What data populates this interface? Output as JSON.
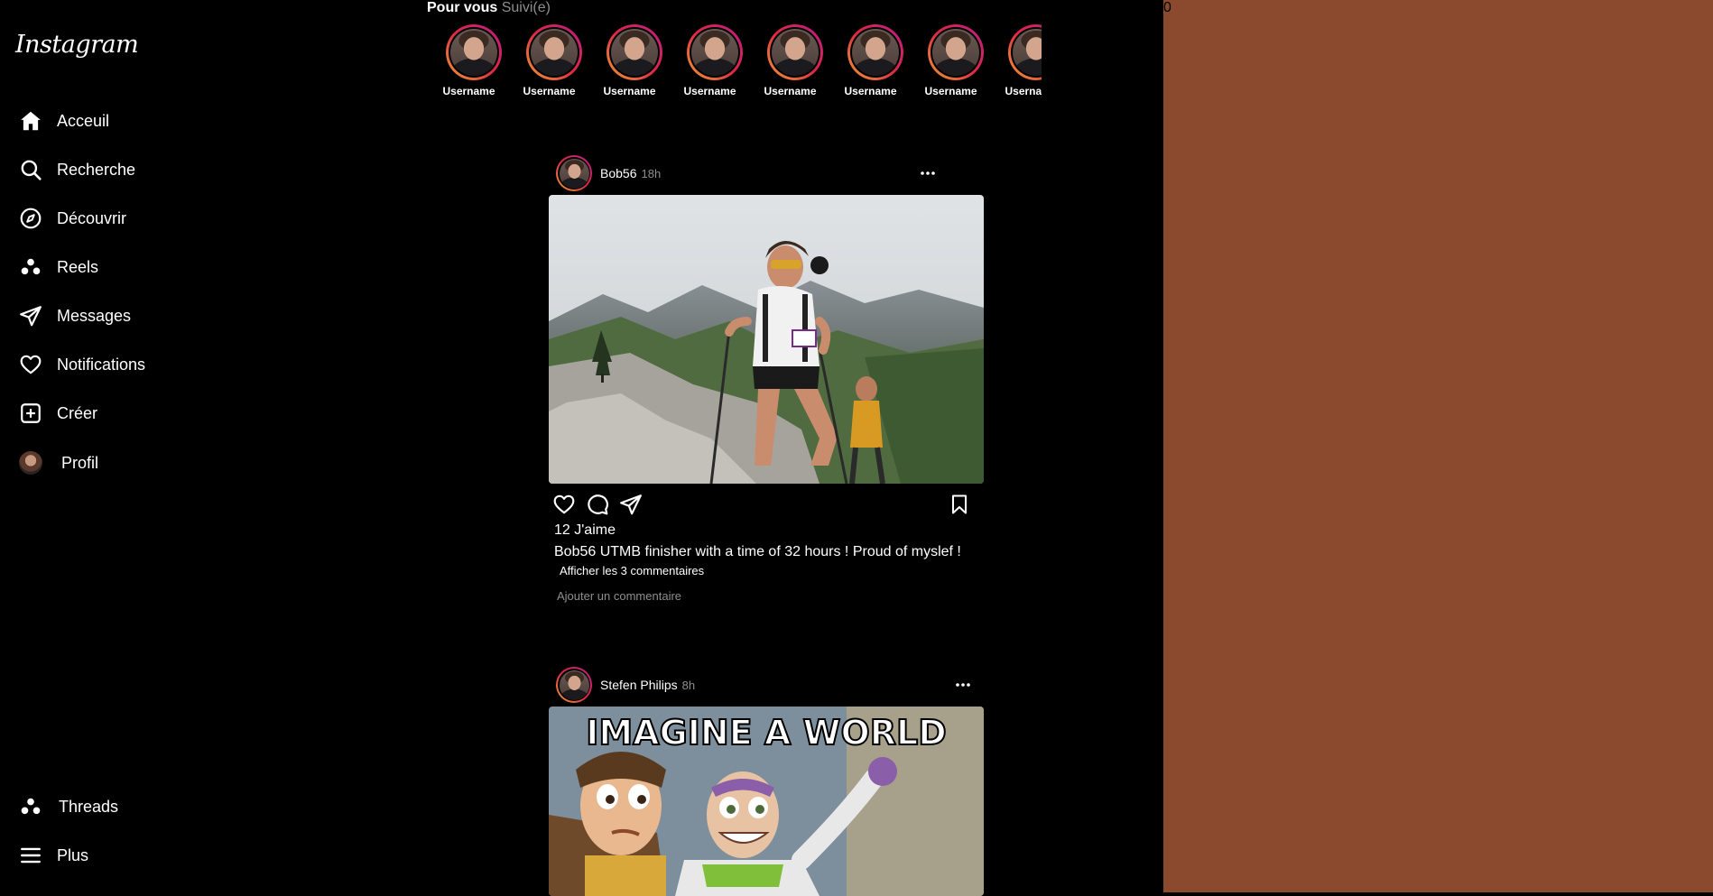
{
  "app": {
    "logo_text": "Instagram",
    "right_panel_text": "0",
    "colors": {
      "background": "#000000",
      "right_panel": "#8B4A2E",
      "muted_text": "#8e8e8e",
      "story_ring_gradient": [
        "#f09433",
        "#e6683c",
        "#dc2743",
        "#cc2366",
        "#bc1888"
      ]
    }
  },
  "sidebar": {
    "items": [
      {
        "label": "Acceuil",
        "icon": "home-icon"
      },
      {
        "label": "Recherche",
        "icon": "search-icon"
      },
      {
        "label": "Découvrir",
        "icon": "compass-icon"
      },
      {
        "label": "Reels",
        "icon": "reels-icon"
      },
      {
        "label": "Messages",
        "icon": "paper-plane-icon"
      },
      {
        "label": "Notifications",
        "icon": "heart-icon"
      },
      {
        "label": "Créer",
        "icon": "plus-square-icon"
      },
      {
        "label": "Profil",
        "icon": "profile-avatar"
      }
    ],
    "bottom_items": [
      {
        "label": "Threads",
        "icon": "threads-icon"
      },
      {
        "label": "Plus",
        "icon": "menu-icon"
      }
    ]
  },
  "feed": {
    "tabs": {
      "active": "Pour vous",
      "inactive": "Suivi(e)"
    },
    "stories": [
      {
        "username": "Username"
      },
      {
        "username": "Username"
      },
      {
        "username": "Username"
      },
      {
        "username": "Username"
      },
      {
        "username": "Username"
      },
      {
        "username": "Username"
      },
      {
        "username": "Username"
      },
      {
        "username": "Username"
      }
    ],
    "posts": [
      {
        "user": "Bob56",
        "time": "18h",
        "image": "trail-runner-photo",
        "likes": "12 J'aime",
        "caption_user": "Bob56",
        "caption_text": "UTMB finisher with a time of 32 hours ! Proud of myslef !",
        "view_comments": "Afficher les 3 commentaires",
        "comment_placeholder": "Ajouter un commentaire"
      },
      {
        "user": "Stefen Philips",
        "time": "8h",
        "image": "toy-story-meme",
        "meme_text": "IMAGINE A WORLD"
      }
    ]
  }
}
